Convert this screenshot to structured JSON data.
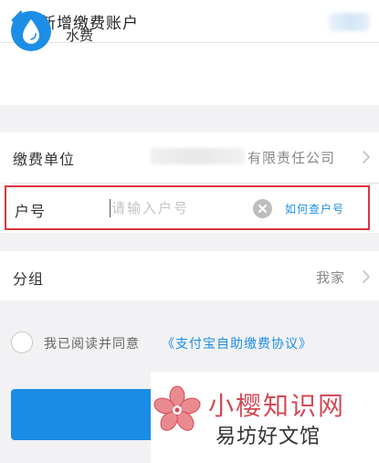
{
  "header": {
    "title": "新增缴费账户",
    "back_icon": "chevron-left-icon"
  },
  "biller": {
    "icon": "water-drop-icon",
    "name": "水费"
  },
  "form": {
    "unit": {
      "label": "缴费单位",
      "value": "有限责任公司"
    },
    "account": {
      "label": "户号",
      "placeholder": "请输入户号",
      "help_link": "如何查户号"
    },
    "group": {
      "label": "分组",
      "value": "我家"
    }
  },
  "agreement": {
    "text": "我已阅读并同意",
    "link": "《支付宝自助缴费协议》"
  },
  "watermark": {
    "line1": "小樱知识网",
    "line2": "易坊好文馆"
  },
  "colors": {
    "accent": "#1d8ee6",
    "highlight_border": "#d9363e",
    "watermark_red": "#d24b57"
  }
}
